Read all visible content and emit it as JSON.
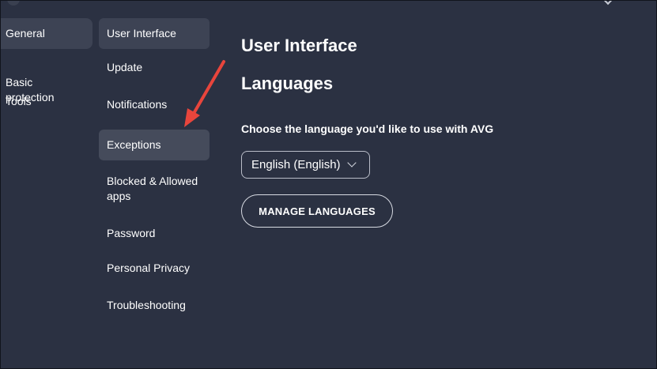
{
  "primary_nav": {
    "items": [
      {
        "label": "General"
      },
      {
        "label": "Basic\nprotection"
      },
      {
        "label": "Tools"
      }
    ]
  },
  "secondary_nav": {
    "items": [
      {
        "label": "User Interface"
      },
      {
        "label": "Update"
      },
      {
        "label": "Notifications"
      },
      {
        "label": "Exceptions"
      },
      {
        "label": "Blocked & Allowed\napps"
      },
      {
        "label": "Password"
      },
      {
        "label": "Personal Privacy"
      },
      {
        "label": "Troubleshooting"
      }
    ]
  },
  "main": {
    "title": "User Interface",
    "section_title": "Languages",
    "choose_label": "Choose the language you'd like to use with AVG",
    "language_select_value": "English (English)",
    "manage_button_label": "MANAGE LANGUAGES"
  },
  "colors": {
    "background": "#2b3142",
    "selected_item": "#3d4354",
    "annotation_arrow": "#e8453c"
  },
  "icons": {
    "dropdown": "chevron-down-icon",
    "annotation": "red-arrow-icon"
  }
}
